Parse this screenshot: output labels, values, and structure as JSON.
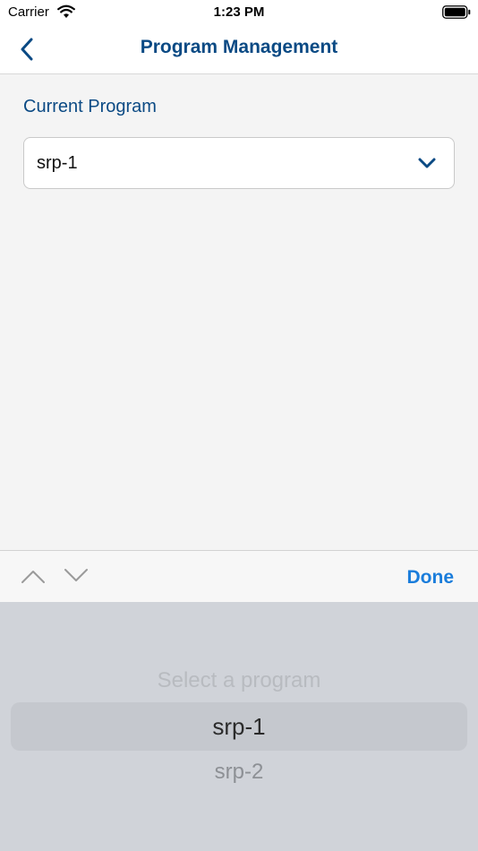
{
  "status_bar": {
    "carrier": "Carrier",
    "time": "1:23 PM",
    "wifi_icon": "wifi-icon",
    "battery_icon": "battery-icon"
  },
  "nav": {
    "title": "Program Management",
    "back_icon": "chevron-left-icon",
    "accent_color": "#0b4a84"
  },
  "form": {
    "label": "Current Program",
    "selected_value": "srp-1",
    "chevron_icon": "chevron-down-icon"
  },
  "toolbar": {
    "prev_icon": "chevron-up-icon",
    "next_icon": "chevron-down-icon",
    "done_label": "Done",
    "done_color": "#1a7ddb"
  },
  "picker": {
    "options": [
      "Select a program",
      "srp-1",
      "srp-2"
    ],
    "selected_index": 1
  }
}
